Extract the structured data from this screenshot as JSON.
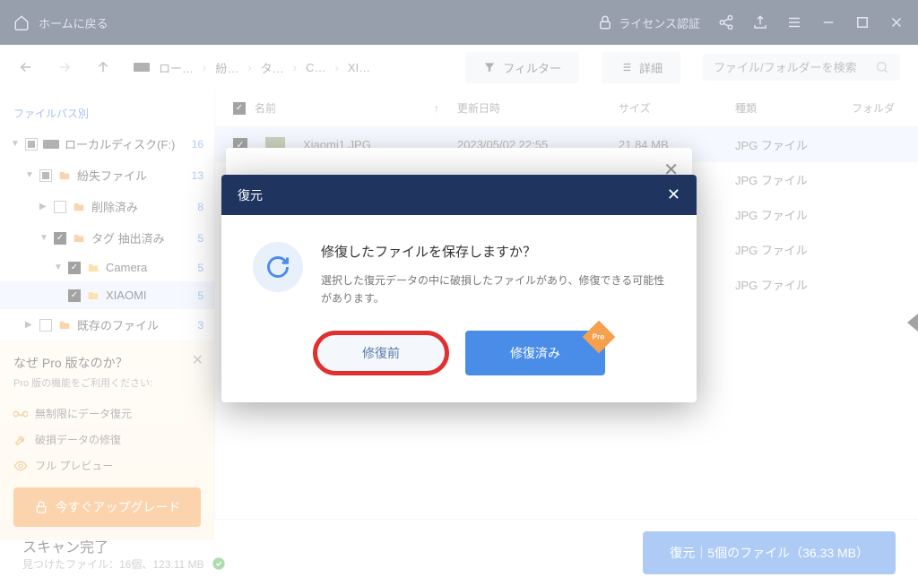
{
  "titlebar": {
    "back_home": "ホームに戻る",
    "license": "ライセンス認証"
  },
  "toolbar": {
    "breadcrumb": [
      "ロー…",
      "紛…",
      "タ…",
      "C…",
      "XI…"
    ],
    "filter": "フィルター",
    "detail": "詳細",
    "search_placeholder": "ファイル/フォルダーを検索"
  },
  "sidebar": {
    "header": "ファイルパス別",
    "items": [
      {
        "label": "ローカルディスク(F:)",
        "count": 16
      },
      {
        "label": "紛失ファイル",
        "count": 13
      },
      {
        "label": "削除済み",
        "count": 8
      },
      {
        "label": "タグ 抽出済み",
        "count": 5
      },
      {
        "label": "Camera",
        "count": 5
      },
      {
        "label": "XIAOMI",
        "count": 5
      },
      {
        "label": "既存のファイル",
        "count": 3
      }
    ]
  },
  "promo": {
    "title": "なぜ Pro 版なのか？",
    "sub": "Pro 版の機能をご利用ください:",
    "feat1": "無制限にデータ復元",
    "feat2": "破損データの修復",
    "feat3": "フル プレビュー",
    "upgrade": "今すぐアップグレード"
  },
  "list": {
    "headers": {
      "name": "名前",
      "date": "更新日時",
      "size": "サイズ",
      "type": "種類",
      "folder": "フォルダ"
    },
    "rows": [
      {
        "name": "Xiaomi1.JPG",
        "date": "2023/05/02 22:55",
        "size": "21.84 MB",
        "type": "JPG ファイル"
      },
      {
        "type": "JPG ファイル"
      },
      {
        "type": "JPG ファイル"
      },
      {
        "type": "JPG ファイル"
      },
      {
        "type": "JPG ファイル"
      }
    ]
  },
  "footer": {
    "title": "スキャン完了",
    "sub": "見つけたファイル：16個、123.11 MB",
    "recover": "復元｜5個のファイル（36.33 MB）"
  },
  "modal": {
    "head": "復元",
    "title": "修復したファイルを保存しますか？",
    "desc": "選択した復元データの中に破損したファイルがあり、修復できる可能性があります。",
    "before": "修復前",
    "after": "修復済み",
    "pro": "Pro"
  }
}
